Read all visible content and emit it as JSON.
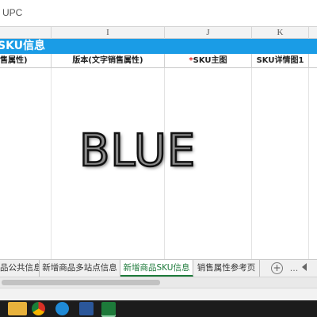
{
  "formula_bar": {
    "value": "UPC"
  },
  "columns": [
    "I",
    "J",
    "K"
  ],
  "sheet": {
    "section_title": "SKU信息",
    "headers": {
      "partial_left": "售属性)",
      "version": "版本(文字销售属性)",
      "sku_main_image_required": "*",
      "sku_main_image": "SKU主图",
      "sku_detail_image_1": "SKU详情图1"
    }
  },
  "overlay": {
    "text": "BLUE"
  },
  "tabs": [
    {
      "label": "品公共信息",
      "active": false
    },
    {
      "label": "新增商品多站点信息",
      "active": false
    },
    {
      "label": "新增商品SKU信息",
      "active": true
    },
    {
      "label": "销售属性参考页",
      "active": false
    }
  ],
  "tab_controls": {
    "add": "+",
    "more": "..."
  },
  "icons": {
    "add_sheet": "plus-circle-icon",
    "more": "ellipsis-icon",
    "scroll_left": "triangle-left-icon"
  },
  "colors": {
    "title_bar": "#1a9ce6",
    "active_tab": "#1d7a3a",
    "required_marker": "#e02020"
  }
}
